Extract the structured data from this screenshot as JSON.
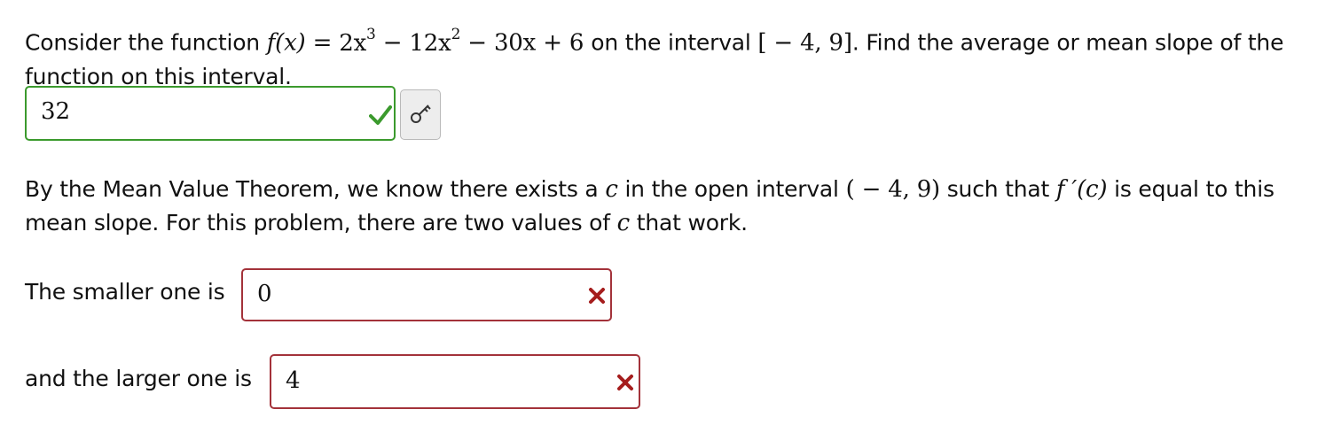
{
  "question1": {
    "prefix": "Consider the function",
    "function_lhs": "f(x)",
    "equals": "=",
    "term1": "2x",
    "exp1": "3",
    "minus1": "−",
    "term2": "12x",
    "exp2": "2",
    "minus2": "−",
    "term3": "30x",
    "plus": "+",
    "term4": "6",
    "interval_text": "on the interval",
    "interval": "[ − 4, 9]",
    "suffix": ". Find the average or mean slope of the function on this interval."
  },
  "answer1": {
    "value": "32",
    "status": "correct"
  },
  "question2": {
    "part1": "By the Mean Value Theorem, we know there exists a",
    "c1": "c",
    "part2": "in the open interval",
    "open_interval": "( − 4, 9)",
    "part3": "such that",
    "fprime": "f ′(c)",
    "part4": "is equal to this mean slope. For this problem, there are two values of",
    "c2": "c",
    "part5": "that work."
  },
  "smaller": {
    "label": "The smaller one is",
    "value": "0",
    "status": "incorrect"
  },
  "larger": {
    "label": "and the larger one is",
    "value": "4",
    "status": "incorrect"
  },
  "colors": {
    "correct": "#3b9a2d",
    "incorrect": "#a3323a",
    "x_mark": "#a51d1d"
  },
  "icons": {
    "correct_mark": "check-icon",
    "incorrect_mark": "close-icon",
    "key_button": "key-icon"
  }
}
